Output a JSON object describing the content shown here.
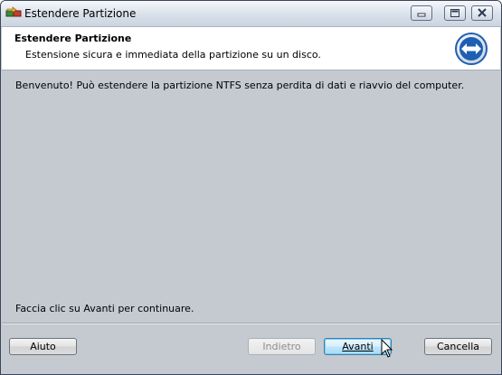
{
  "window": {
    "title": "Estendere Partizione"
  },
  "header": {
    "title": "Estendere Partizione",
    "subtitle": "Estensione sicura e immediata della partizione su un disco."
  },
  "content": {
    "welcome_text": "Benvenuto! Può estendere la partizione NTFS senza perdita di dati e riavvio del computer.",
    "continue_text": "Faccia clic su Avanti per continuare."
  },
  "buttons": {
    "help": "Aiuto",
    "back": "Indietro",
    "next": "Avanti",
    "cancel": "Cancella"
  },
  "icons": {
    "app": "partition-app-icon",
    "header": "extend-arrows-icon",
    "cursor": "mouse-pointer-icon"
  },
  "colors": {
    "content_bg": "#c5cad1",
    "header_icon_blue": "#1e5fb4"
  }
}
